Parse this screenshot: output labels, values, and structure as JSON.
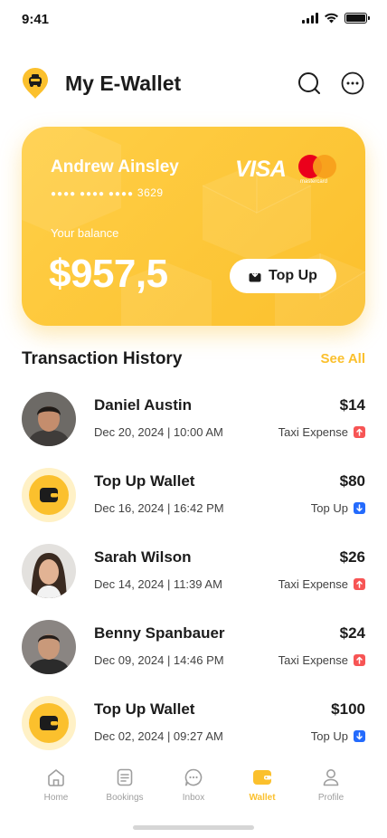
{
  "status_bar": {
    "time": "9:41"
  },
  "header": {
    "title": "My E-Wallet",
    "logo_icon": "taxi-logo-icon",
    "search_icon": "search-icon",
    "more_icon": "more-icon"
  },
  "card": {
    "holder": "Andrew Ainsley",
    "number_mask": "●●●● ●●●● ●●●●",
    "number_last4": "3629",
    "brand_visa": "VISA",
    "brand_mastercard": "mastercard",
    "balance_label": "Your balance",
    "balance": "$957,5",
    "topup_label": "Top Up"
  },
  "section": {
    "title": "Transaction History",
    "see_all": "See All"
  },
  "transactions": [
    {
      "name": "Daniel Austin",
      "date": "Dec 20, 2024 | 10:00 AM",
      "amount": "$14",
      "type": "Taxi Expense",
      "direction": "up",
      "avatar": "person"
    },
    {
      "name": "Top Up Wallet",
      "date": "Dec 16, 2024 | 16:42 PM",
      "amount": "$80",
      "type": "Top Up",
      "direction": "down",
      "avatar": "wallet"
    },
    {
      "name": "Sarah Wilson",
      "date": "Dec 14, 2024 | 11:39 AM",
      "amount": "$26",
      "type": "Taxi Expense",
      "direction": "up",
      "avatar": "person"
    },
    {
      "name": "Benny Spanbauer",
      "date": "Dec 09, 2024 | 14:46 PM",
      "amount": "$24",
      "type": "Taxi Expense",
      "direction": "up",
      "avatar": "person"
    },
    {
      "name": "Top Up Wallet",
      "date": "Dec 02, 2024 | 09:27 AM",
      "amount": "$100",
      "type": "Top Up",
      "direction": "down",
      "avatar": "wallet"
    }
  ],
  "nav": [
    {
      "label": "Home",
      "icon": "home-icon",
      "active": false
    },
    {
      "label": "Bookings",
      "icon": "bookings-icon",
      "active": false
    },
    {
      "label": "Inbox",
      "icon": "inbox-icon",
      "active": false
    },
    {
      "label": "Wallet",
      "icon": "wallet-icon",
      "active": true
    },
    {
      "label": "Profile",
      "icon": "profile-icon",
      "active": false
    }
  ],
  "colors": {
    "primary": "#FBC02D",
    "primary_light": "#FFF1C6",
    "text": "#1C1C1C",
    "muted": "#9E9E9E",
    "expense": "#F75555",
    "topup": "#246BFD"
  }
}
